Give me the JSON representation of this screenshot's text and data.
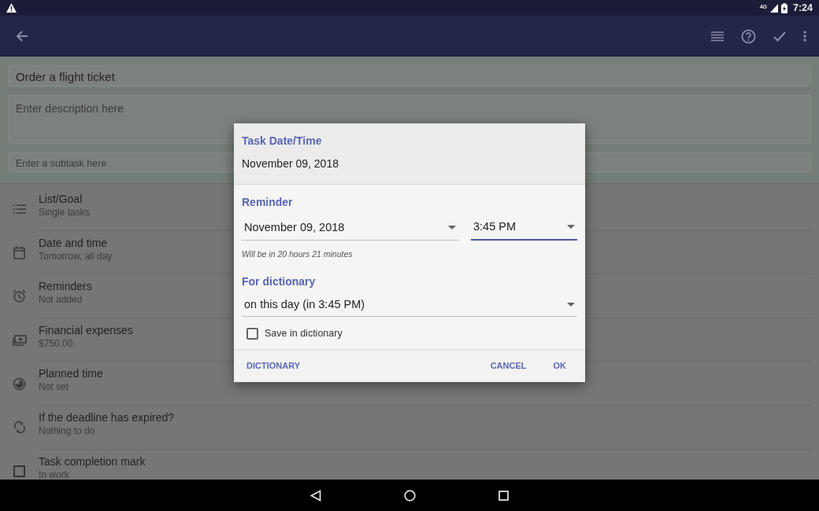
{
  "status_bar": {
    "network": "4G",
    "time": "7:24"
  },
  "task": {
    "title": "Order a flight ticket",
    "description_placeholder": "Enter description here",
    "subtask_placeholder": "Enter a subtask here"
  },
  "settings": [
    {
      "kind": "list",
      "label": "List/Goal",
      "value": "Single tasks"
    },
    {
      "kind": "calendar",
      "label": "Date and time",
      "value": "Tomorrow, all day"
    },
    {
      "kind": "alarm",
      "label": "Reminders",
      "value": "Not added"
    },
    {
      "kind": "money",
      "label": "Financial expenses",
      "value": "$750.00"
    },
    {
      "kind": "clock",
      "label": "Planned time",
      "value": "Not set"
    },
    {
      "kind": "repeat",
      "label": "If the deadline has expired?",
      "value": "Nothing to do"
    },
    {
      "kind": "checkbox",
      "label": "Task completion mark",
      "value": "In work",
      "checked": false
    }
  ],
  "dialog": {
    "title": "Task Date/Time",
    "date": "November 09, 2018",
    "reminder_label": "Reminder",
    "reminder_fields": [
      {
        "value": "November 09, 2018",
        "focused": false
      },
      {
        "value": "3:45 PM",
        "focused": true
      }
    ],
    "hint": "Will be in 20 hours 21 minutes",
    "dictionary_label": "For dictionary",
    "dictionary_option": "on this day (in 3:45 PM)",
    "save_checkbox": {
      "label": "Save in dictionary",
      "checked": false
    },
    "neutral_button": "DICTIONARY",
    "buttons": [
      "CANCEL",
      "OK"
    ]
  }
}
